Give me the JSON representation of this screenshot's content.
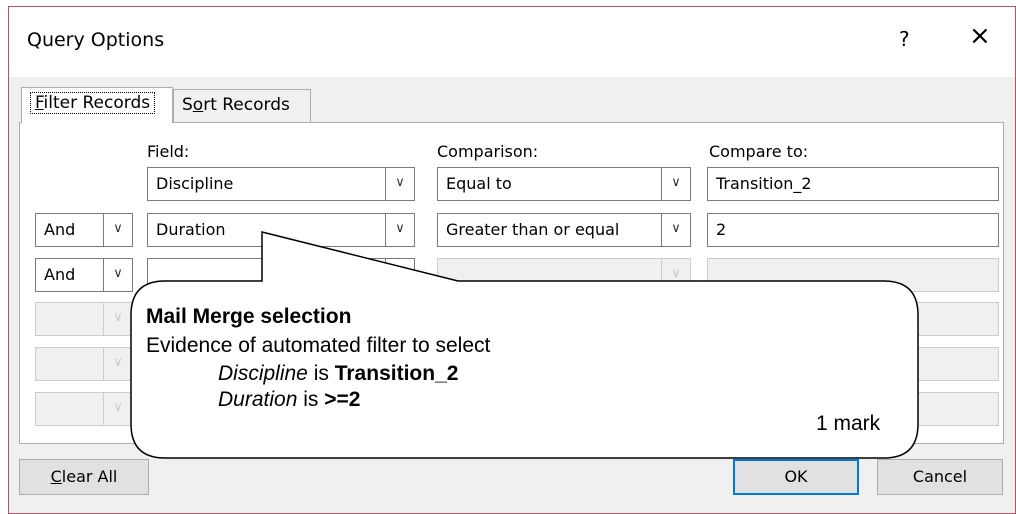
{
  "dialog": {
    "title": "Query Options",
    "help_label": "?",
    "close_label": "×"
  },
  "tabs": {
    "filter": {
      "prefix": "",
      "mnemonic": "F",
      "rest": "ilter Records"
    },
    "sort": {
      "prefix": "S",
      "mnemonic": "o",
      "rest": "rt Records"
    }
  },
  "headers": {
    "field": "Field:",
    "comparison": "Comparison:",
    "compare_to": "Compare to:"
  },
  "rows": [
    {
      "operator": "",
      "field": "Discipline",
      "comparison": "Equal to",
      "compare_to": "Transition_2"
    },
    {
      "operator": "And",
      "field": "Duration",
      "comparison": "Greater than or equal",
      "compare_to": "2"
    },
    {
      "operator": "And",
      "field": "",
      "comparison": "",
      "compare_to": ""
    },
    {
      "operator": "",
      "field": "",
      "comparison": "",
      "compare_to": ""
    },
    {
      "operator": "",
      "field": "",
      "comparison": "",
      "compare_to": ""
    },
    {
      "operator": "",
      "field": "",
      "comparison": "",
      "compare_to": ""
    }
  ],
  "buttons": {
    "clear_all": {
      "mnemonic": "C",
      "rest": "lear All"
    },
    "ok": "OK",
    "cancel": "Cancel"
  },
  "callout": {
    "heading": "Mail Merge selection",
    "line1": "Evidence of automated filter to select",
    "line2_italic": "Discipline",
    "line2_mid": " is ",
    "line2_bold": "Transition_2",
    "line3_italic": "Duration",
    "line3_mid": " is ",
    "line3_bold": ">=2",
    "marks": "1 mark"
  },
  "icons": {
    "dropdown": "chevron-down",
    "close": "close-x",
    "help": "question-mark"
  },
  "colors": {
    "dialog_border": "#b0526a",
    "ok_focus": "#0078d7",
    "dialog_bg": "#f0f0f0"
  }
}
